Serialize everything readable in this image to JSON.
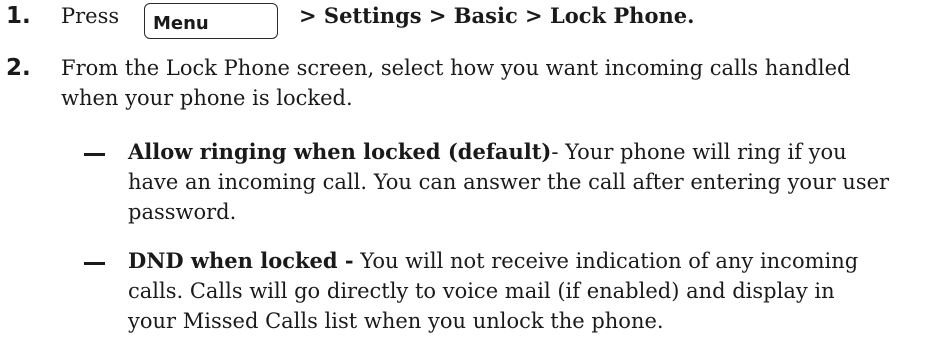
{
  "steps": [
    {
      "number": "1.",
      "press_word": "Press",
      "menu_key_label": "Menu",
      "path_text": "> Settings > Basic > Lock Phone."
    },
    {
      "number": "2.",
      "lines": [
        "From the Lock Phone screen, select how you want incoming calls handled",
        "when your phone is locked."
      ],
      "options": [
        {
          "title": "Allow ringing when locked (default)",
          "title_suffix": "-",
          "first_line_rest": " Your phone will ring if you",
          "continuation_lines": [
            "have an incoming call. You can answer the call after entering your user",
            "password."
          ]
        },
        {
          "title": "DND when locked -",
          "first_line_rest": " You will not receive indication of any incoming",
          "continuation_lines": [
            "calls. Calls will go directly to voice mail (if enabled) and display in",
            "your Missed Calls list when you unlock the phone."
          ]
        }
      ]
    }
  ]
}
